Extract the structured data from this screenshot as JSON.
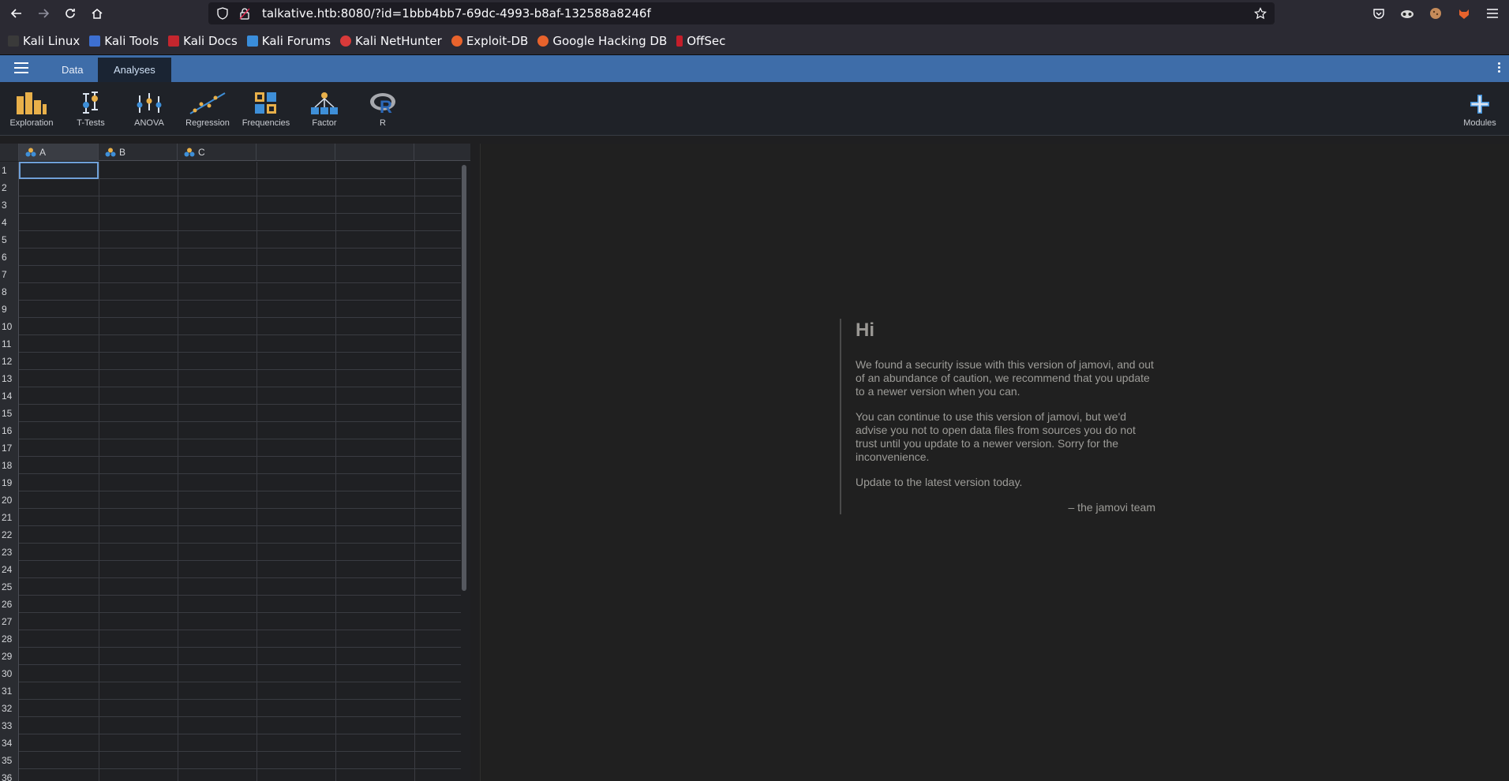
{
  "browser": {
    "url": "talkative.htb:8080/?id=1bbb4bb7-69dc-4993-b8af-132588a8246f",
    "bookmarks": [
      "Kali Linux",
      "Kali Tools",
      "Kali Docs",
      "Kali Forums",
      "Kali NetHunter",
      "Exploit-DB",
      "Google Hacking DB",
      "OffSec"
    ]
  },
  "app": {
    "tabs": [
      "Data",
      "Analyses"
    ],
    "active_tab": "Analyses",
    "tools": [
      "Exploration",
      "T-Tests",
      "ANOVA",
      "Regression",
      "Frequencies",
      "Factor",
      "R"
    ],
    "modules_label": "Modules"
  },
  "sheet": {
    "columns": [
      "A",
      "B",
      "C"
    ],
    "row_numbers": [
      "1",
      "2",
      "3",
      "4",
      "5",
      "6",
      "7",
      "8",
      "9",
      "10",
      "11",
      "12",
      "13",
      "14",
      "15",
      "16",
      "17",
      "18",
      "19",
      "20",
      "21",
      "22",
      "23",
      "24",
      "25",
      "26",
      "27",
      "28",
      "29",
      "30",
      "31",
      "32",
      "33",
      "34",
      "35",
      "36"
    ]
  },
  "notice": {
    "title": "Hi",
    "para1": "We found a security issue with this version of jamovi, and out of an abundance of caution, we recommend that you update to a newer version when you can.",
    "para2": "You can continue to use this version of jamovi, but we'd advise you not to open data files from sources you do not trust until you update to a newer version. Sorry for the inconvenience.",
    "para3": "Update to the latest version today.",
    "signature": "– the jamovi team"
  }
}
